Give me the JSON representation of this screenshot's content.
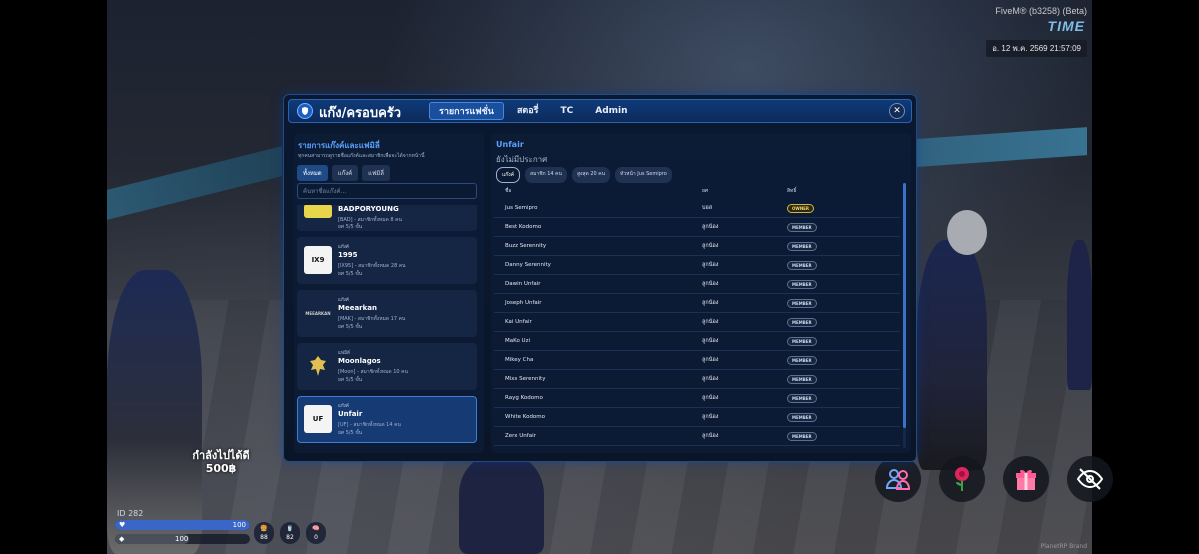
{
  "overlay": {
    "fivem_label": "FiveM® (b3258) (Beta)",
    "brand": "TIME",
    "clock": "อ. 12 พ.ค. 2569 21:57:09"
  },
  "hud": {
    "money_label": "กำลังไปได้ดี",
    "money_value": "500฿",
    "player_id": "282",
    "health": "100",
    "armor": "100",
    "stats": [
      "88",
      "82",
      "0"
    ],
    "corner_label": "PlanetRP Brand"
  },
  "panel": {
    "title": "แก๊ง/ครอบครัว",
    "tabs": [
      {
        "label": "รายการแฟชั่น",
        "active": true
      },
      {
        "label": "สตอรี่",
        "active": false
      },
      {
        "label": "TC",
        "active": false
      },
      {
        "label": "Admin",
        "active": false
      }
    ],
    "close": "✕"
  },
  "left": {
    "heading": "รายการแก๊งค์และแฟมิลี่",
    "subtitle": "ทุกคนสามารถดูรายชื่อแก๊งค์และสมาชิกเพื่อจะได้จากหน้านี้",
    "filters": [
      {
        "label": "ทั้งหมด",
        "active": true
      },
      {
        "label": "แก๊งค์",
        "active": false
      },
      {
        "label": "แฟมิลี่",
        "active": false
      }
    ],
    "search_placeholder": "ค้นหาชื่อแก๊งค์...",
    "gangs": [
      {
        "logo": "",
        "logo_style": "first",
        "type": "",
        "name": "BADPORYOUNG",
        "meta": "[BAD] - สมาชิกทั้งหมด 8 คน",
        "cap": "ยศ 5/5 ขั้น",
        "selected": false
      },
      {
        "logo": "IX9",
        "logo_style": "white",
        "type": "แก๊งค์",
        "name": "1995",
        "meta": "[IX95] - สมาชิกทั้งหมด 28 คน",
        "cap": "ยศ 5/5 ขั้น",
        "selected": false
      },
      {
        "logo": "MEEARKAN",
        "logo_style": "dark",
        "type": "แก๊งค์",
        "name": "Meearkan",
        "meta": "[MAK] - สมาชิกทั้งหมด 17 คน",
        "cap": "ยศ 5/5 ขั้น",
        "selected": false
      },
      {
        "logo": "",
        "logo_style": "gold",
        "type": "แฟมิลี่",
        "name": "Moonlagos",
        "meta": "[Moon] - สมาชิกทั้งหมด 10 คน",
        "cap": "ยศ 5/5 ขั้น",
        "selected": false
      },
      {
        "logo": "UF",
        "logo_style": "white",
        "type": "แก๊งค์",
        "name": "Unfair",
        "meta": "[UF] - สมาชิกทั้งหมด 14 คน",
        "cap": "ยศ 5/5 ขั้น",
        "selected": true
      }
    ]
  },
  "right": {
    "gang_name": "Unfair",
    "announcement": "ยังไม่มีประกาศ",
    "chips": [
      {
        "label": "แก๊งค์",
        "active": true
      },
      {
        "label": "สมาชิก 14 คน",
        "active": false
      },
      {
        "label": "สูงสุด 20 คน",
        "active": false
      },
      {
        "label": "หัวหน้า Jus Semipro",
        "active": false
      }
    ],
    "columns": {
      "name": "ชื่อ",
      "rank": "ยศ",
      "role": "สิทธิ์"
    },
    "members": [
      {
        "name": "Jus Semipro",
        "rank": "บอส",
        "role": "OWNER"
      },
      {
        "name": "Best Kodomo",
        "rank": "ลูกน้อง",
        "role": "MEMBER"
      },
      {
        "name": "Buzz Serennity",
        "rank": "ลูกน้อง",
        "role": "MEMBER"
      },
      {
        "name": "Danny Serennity",
        "rank": "ลูกน้อง",
        "role": "MEMBER"
      },
      {
        "name": "Dawin Unfair",
        "rank": "ลูกน้อง",
        "role": "MEMBER"
      },
      {
        "name": "Joseph Unfair",
        "rank": "ลูกน้อง",
        "role": "MEMBER"
      },
      {
        "name": "Kai Unfair",
        "rank": "ลูกน้อง",
        "role": "MEMBER"
      },
      {
        "name": "MaKo Uzi",
        "rank": "ลูกน้อง",
        "role": "MEMBER"
      },
      {
        "name": "Mikey Cha",
        "rank": "ลูกน้อง",
        "role": "MEMBER"
      },
      {
        "name": "Mixs Serennity",
        "rank": "ลูกน้อง",
        "role": "MEMBER"
      },
      {
        "name": "Rayg Kodomo",
        "rank": "ลูกน้อง",
        "role": "MEMBER"
      },
      {
        "name": "White Kodomo",
        "rank": "ลูกน้อง",
        "role": "MEMBER"
      },
      {
        "name": "Zerx Unfair",
        "rank": "ลูกน้อง",
        "role": "MEMBER"
      }
    ]
  },
  "actions": [
    {
      "icon": "people-icon"
    },
    {
      "icon": "rose-icon"
    },
    {
      "icon": "gift-icon"
    },
    {
      "icon": "eye-off-icon"
    }
  ],
  "colors": {
    "accent": "#5aa1ff",
    "panel_bg": "#0a1930",
    "owner_badge": "#d4b43a"
  }
}
